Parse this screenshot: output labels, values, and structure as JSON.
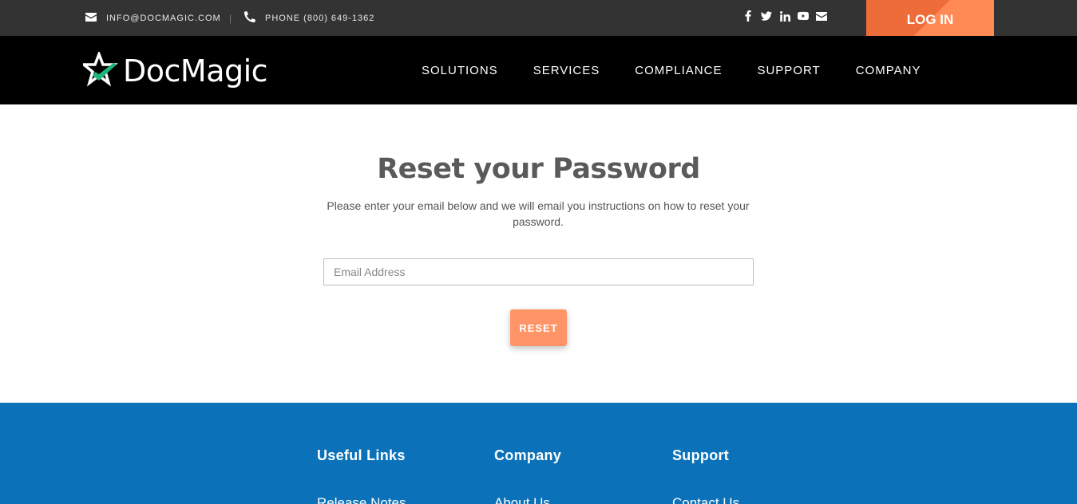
{
  "topbar": {
    "email": "INFO@DOCMAGIC.COM",
    "separator": "|",
    "phone": "PHONE (800) 649-1362",
    "social_icons": [
      "facebook-icon",
      "twitter-icon",
      "linkedin-icon",
      "youtube-icon",
      "envelope-icon"
    ],
    "login_label": "LOG IN"
  },
  "nav": {
    "brand": "DocMagic",
    "items": [
      "SOLUTIONS",
      "SERVICES",
      "COMPLIANCE",
      "SUPPORT",
      "COMPANY"
    ]
  },
  "main": {
    "title": "Reset your Password",
    "description": "Please enter your email below and we will email you instructions on how to reset your password.",
    "email_placeholder": "Email Address",
    "email_value": "",
    "reset_label": "RESET"
  },
  "footer": {
    "columns": [
      {
        "heading": "Useful Links",
        "first_link": "Release Notes"
      },
      {
        "heading": "Company",
        "first_link": "About Us"
      },
      {
        "heading": "Support",
        "first_link": "Contact Us"
      }
    ]
  },
  "colors": {
    "topbar_bg": "#333333",
    "nav_bg": "#000000",
    "accent_orange": "#ee6b3a",
    "reset_button": "#ff9466",
    "footer_bg": "#0b72b9",
    "logo_green": "#1fb57a"
  }
}
